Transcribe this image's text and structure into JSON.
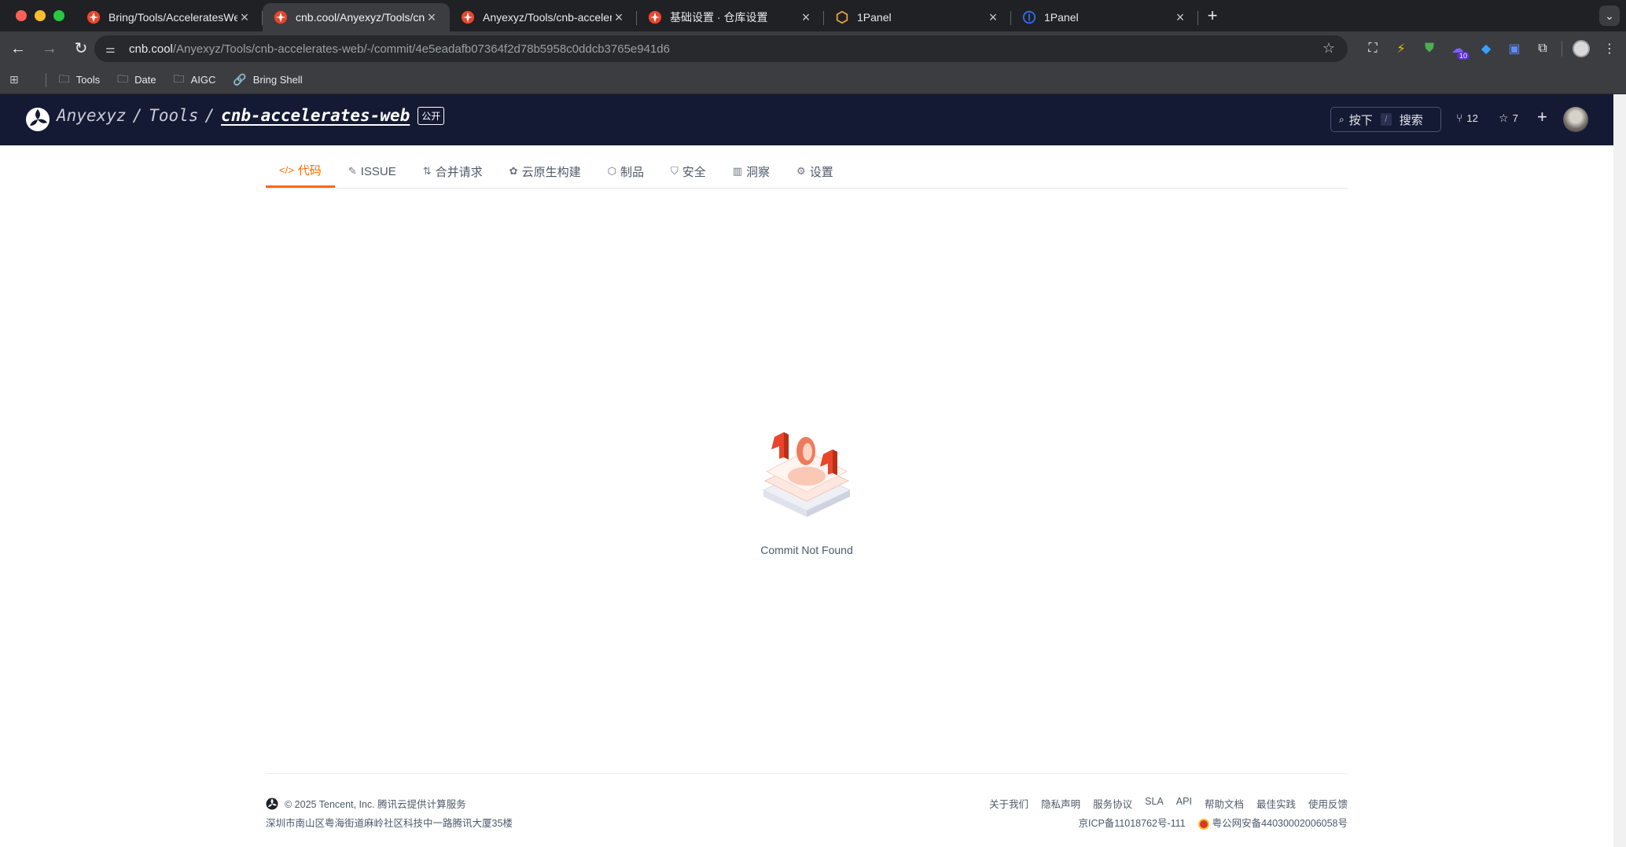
{
  "browser": {
    "tabs": [
      {
        "title": "Bring/Tools/AcceleratesWeb",
        "active": false
      },
      {
        "title": "cnb.cool/Anyexyz/Tools/cnb-accelerates-web",
        "active": true
      },
      {
        "title": "Anyexyz/Tools/cnb-accelerates-web",
        "active": false
      },
      {
        "title": "基础设置 · 仓库设置",
        "active": false
      },
      {
        "title": "1Panel",
        "active": false
      },
      {
        "title": "1Panel",
        "active": false
      }
    ],
    "new_tab_label": "+",
    "url_host": "cnb.cool",
    "url_path": "/Anyexyz/Tools/cnb-accelerates-web/-/commit/4e5eadafb07364f2d78b5958c0ddcb3765e941d6",
    "extension_badge": "10",
    "bookmarks": [
      {
        "label": "Tools"
      },
      {
        "label": "Date"
      },
      {
        "label": "AIGC"
      },
      {
        "label": "Bring Shell"
      }
    ]
  },
  "header": {
    "owner": "Anyexyz",
    "group": "Tools",
    "repo": "cnb-accelerates-web",
    "visibility": "公开",
    "search_press": "按下",
    "search_key": "/",
    "search_label": "搜索",
    "forks": "12",
    "stars": "7"
  },
  "repo_tabs": [
    {
      "label": "代码",
      "icon": "code-icon",
      "glyph": "</>"
    },
    {
      "label": "ISSUE",
      "icon": "issue-icon",
      "glyph": "✎"
    },
    {
      "label": "合并请求",
      "icon": "merge-request-icon",
      "glyph": "⇅"
    },
    {
      "label": "云原生构建",
      "icon": "build-icon",
      "glyph": "✿"
    },
    {
      "label": "制品",
      "icon": "package-icon",
      "glyph": "⬡"
    },
    {
      "label": "安全",
      "icon": "shield-icon",
      "glyph": "⛉"
    },
    {
      "label": "洞察",
      "icon": "insights-icon",
      "glyph": "▥"
    },
    {
      "label": "设置",
      "icon": "settings-icon",
      "glyph": "⚙"
    }
  ],
  "empty_state": {
    "message": "Commit Not Found"
  },
  "footer": {
    "copyright": "© 2025 Tencent, Inc. 腾讯云提供计算服务",
    "address": "深圳市南山区粤海街道麻岭社区科技中一路腾讯大厦35楼",
    "links": [
      "关于我们",
      "隐私声明",
      "服务协议",
      "SLA",
      "API",
      "帮助文档",
      "最佳实践",
      "使用反馈"
    ],
    "icp": "京ICP备11018762号-111",
    "police": "粤公网安备44030002006058号"
  },
  "colors": {
    "header_bg": "#141a33",
    "accent": "#ff6a00"
  }
}
